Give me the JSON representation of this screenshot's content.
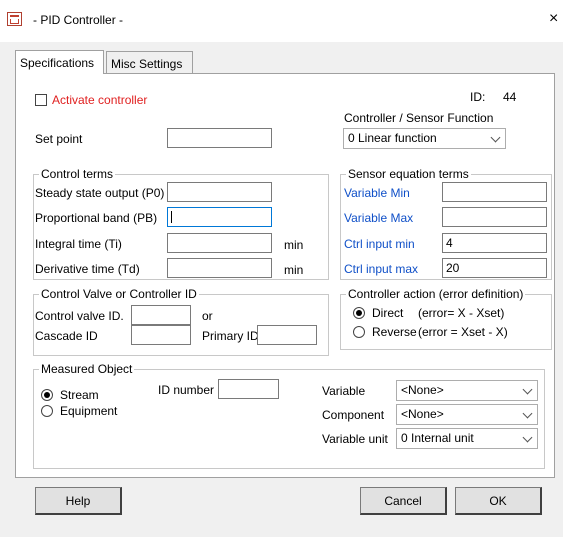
{
  "window": {
    "title": "- PID Controller -",
    "close": "×"
  },
  "tabs": [
    {
      "label": "Specifications"
    },
    {
      "label": "Misc Settings"
    }
  ],
  "activate": {
    "label": "Activate controller",
    "checked": false
  },
  "id_info": {
    "label": "ID:",
    "value": "44"
  },
  "sensor_function": {
    "label": "Controller / Sensor Function",
    "value": "0 Linear function"
  },
  "set_point": {
    "label": "Set point",
    "value": ""
  },
  "control_terms": {
    "title": "Control terms",
    "steady": {
      "label": "Steady state output (P0)",
      "value": ""
    },
    "prop": {
      "label": "Proportional band (PB)",
      "value": ""
    },
    "integral": {
      "label": "Integral time (Ti)",
      "value": "",
      "unit": "min"
    },
    "derivative": {
      "label": "Derivative time (Td)",
      "value": "",
      "unit": "min"
    }
  },
  "sensor_terms": {
    "title": "Sensor equation terms",
    "var_min": {
      "label": "Variable Min",
      "value": ""
    },
    "var_max": {
      "label": "Variable Max",
      "value": ""
    },
    "ctrl_min": {
      "label": "Ctrl input min",
      "value": "4"
    },
    "ctrl_max": {
      "label": "Ctrl input max",
      "value": "20"
    }
  },
  "valve": {
    "title": "Control Valve or Controller ID",
    "valve_id": {
      "label": "Control valve ID.",
      "value": ""
    },
    "or": "or",
    "cascade": {
      "label": "Cascade ID",
      "value": ""
    },
    "primary": {
      "label": "Primary ID",
      "value": ""
    }
  },
  "action": {
    "title": "Controller action (error definition)",
    "direct": {
      "label": "Direct",
      "def": "(error= X - Xset)",
      "selected": true
    },
    "reverse": {
      "label": "Reverse",
      "def": "(error = Xset - X)",
      "selected": false
    }
  },
  "measured": {
    "title": "Measured Object",
    "stream": {
      "label": "Stream",
      "selected": true
    },
    "equipment": {
      "label": "Equipment",
      "selected": false
    },
    "id_number": {
      "label": "ID number",
      "value": ""
    },
    "variable": {
      "label": "Variable",
      "value": "<None>"
    },
    "component": {
      "label": "Component",
      "value": "<None>"
    },
    "unit": {
      "label": "Variable unit",
      "value": "0  Internal unit"
    }
  },
  "buttons": {
    "help": "Help",
    "cancel": "Cancel",
    "ok": "OK"
  },
  "colors": {
    "accent_red": "#e02020",
    "label_blue": "#1050c8",
    "focus": "#0078d7"
  }
}
